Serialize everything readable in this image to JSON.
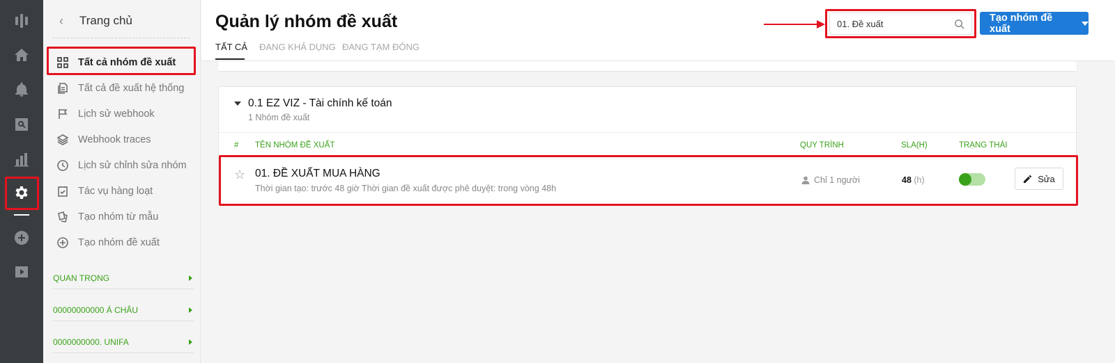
{
  "rail": {
    "icons": [
      "logo-icon",
      "home-icon",
      "bell-icon",
      "search-report-icon",
      "chart-icon",
      "gear-icon",
      "plus-circle-icon",
      "play-icon"
    ],
    "active": "gear-icon"
  },
  "sidebar": {
    "home_label": "Trang chủ",
    "items": [
      {
        "label": "Tất cả nhóm đề xuất",
        "icon": "grid-icon"
      },
      {
        "label": "Tất cả đề xuất hệ thống",
        "icon": "documents-icon"
      },
      {
        "label": "Lịch sử webhook",
        "icon": "flag-icon"
      },
      {
        "label": "Webhook traces",
        "icon": "layers-icon"
      },
      {
        "label": "Lịch sử chỉnh sửa nhóm",
        "icon": "clock-icon"
      },
      {
        "label": "Tác vụ hàng loạt",
        "icon": "checklist-icon"
      },
      {
        "label": "Tạo nhóm từ mẫu",
        "icon": "cards-icon"
      },
      {
        "label": "Tạo nhóm đề xuất",
        "icon": "plus-circle-icon"
      }
    ],
    "groups": [
      "QUAN TRỌNG",
      "00000000000 Á CHÂU",
      "0000000000. UNIFA"
    ]
  },
  "header": {
    "title": "Quản lý nhóm đề xuất",
    "tabs": [
      "TẤT CẢ",
      "ĐANG KHẢ DỤNG",
      "ĐANG TẠM ĐÓNG"
    ],
    "search_value": "01. Đề xuất",
    "create_button": "Tạo nhóm đề xuất"
  },
  "card": {
    "title": "0.1 EZ VIZ - Tài chính kế toán",
    "subtitle": "1 Nhóm đề xuất",
    "columns": [
      "#",
      "TÊN NHÓM ĐỀ XUẤT",
      "QUY TRÌNH",
      "SLA(H)",
      "TRẠNG THÁI"
    ],
    "row": {
      "name": "01. ĐỀ XUẤT MUA HÀNG",
      "desc": "Thời gian tạo: trước 48 giờ Thời gian đề xuất được phê duyệt: trong vòng 48h",
      "process": "Chỉ 1 người",
      "sla_value": "48",
      "sla_unit": "(h)",
      "status_on": true,
      "edit_label": "Sửa"
    }
  },
  "colors": {
    "accent_blue": "#1e7bd7",
    "green": "#3aa21a",
    "highlight_red": "#e4121f",
    "rail_bg": "#3a3d40"
  }
}
